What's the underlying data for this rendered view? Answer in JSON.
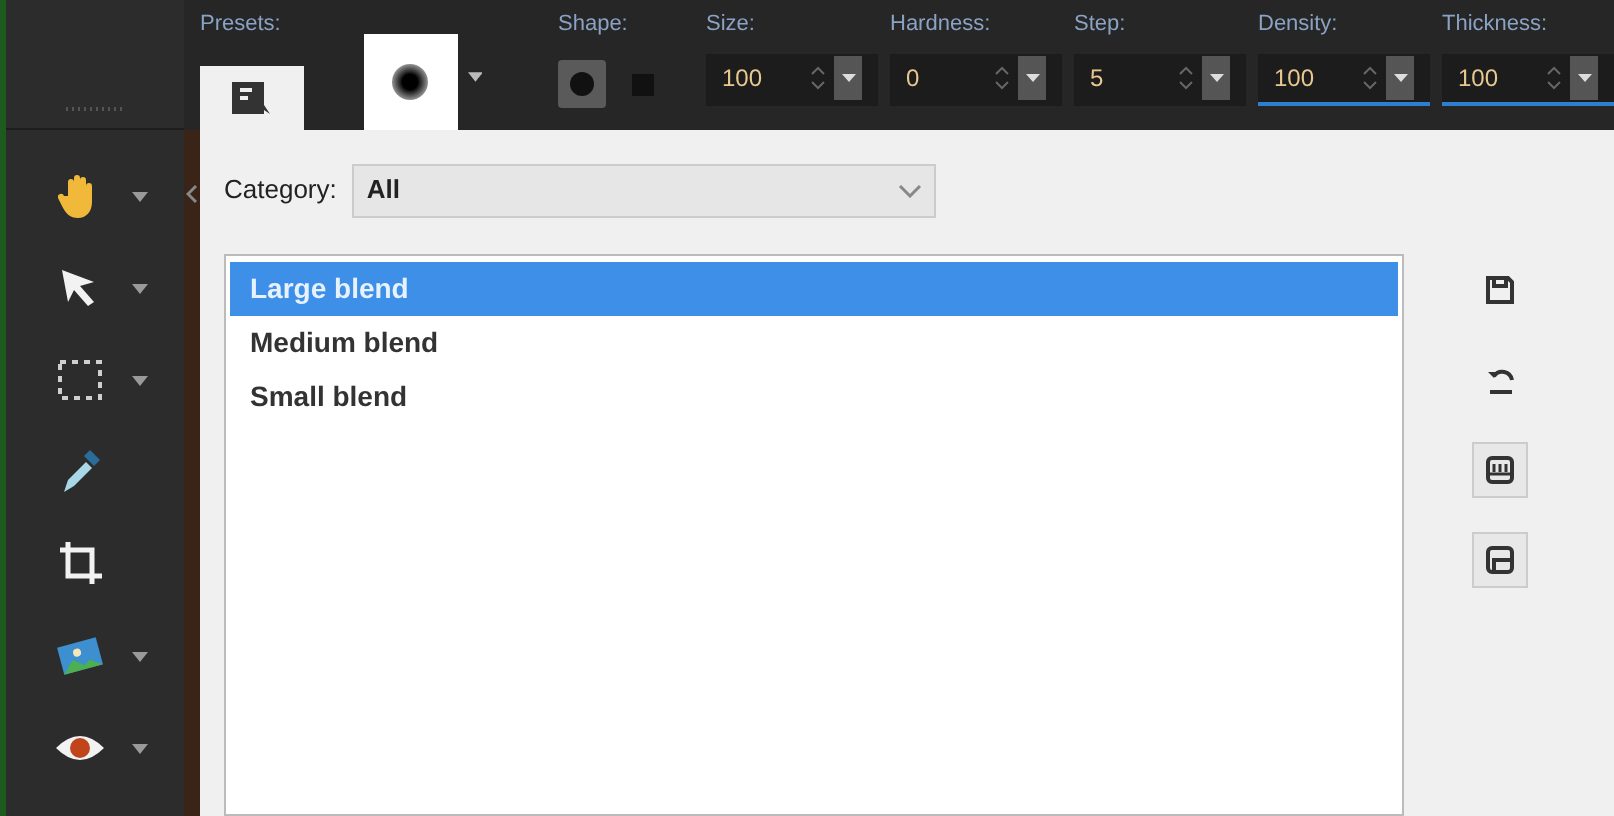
{
  "tools": [
    {
      "kind": "hand",
      "has_menu": true
    },
    {
      "kind": "arrow",
      "has_menu": true
    },
    {
      "kind": "selection",
      "has_menu": true
    },
    {
      "kind": "dropper",
      "has_menu": false
    },
    {
      "kind": "crop",
      "has_menu": false
    },
    {
      "kind": "picture",
      "has_menu": true
    },
    {
      "kind": "eye",
      "has_menu": true
    }
  ],
  "options_bar": {
    "presets_label": "Presets:",
    "shape_label": "Shape:",
    "shapes": [
      {
        "kind": "round",
        "selected": true
      },
      {
        "kind": "square",
        "selected": false
      }
    ],
    "fields": [
      {
        "label": "Size:",
        "value": "100",
        "focused": false
      },
      {
        "label": "Hardness:",
        "value": "0",
        "focused": false
      },
      {
        "label": "Step:",
        "value": "5",
        "focused": false
      },
      {
        "label": "Density:",
        "value": "100",
        "focused": true
      },
      {
        "label": "Thickness:",
        "value": "100",
        "focused": true
      }
    ]
  },
  "dialog": {
    "category_label": "Category:",
    "category_value": "All",
    "presets": [
      {
        "name": "Large blend",
        "selected": true
      },
      {
        "name": "Medium blend",
        "selected": false
      },
      {
        "name": "Small blend",
        "selected": false
      }
    ],
    "side_buttons": [
      {
        "kind": "save",
        "framed": false
      },
      {
        "kind": "reset",
        "framed": false
      },
      {
        "kind": "import",
        "framed": true
      },
      {
        "kind": "export",
        "framed": true
      }
    ]
  }
}
